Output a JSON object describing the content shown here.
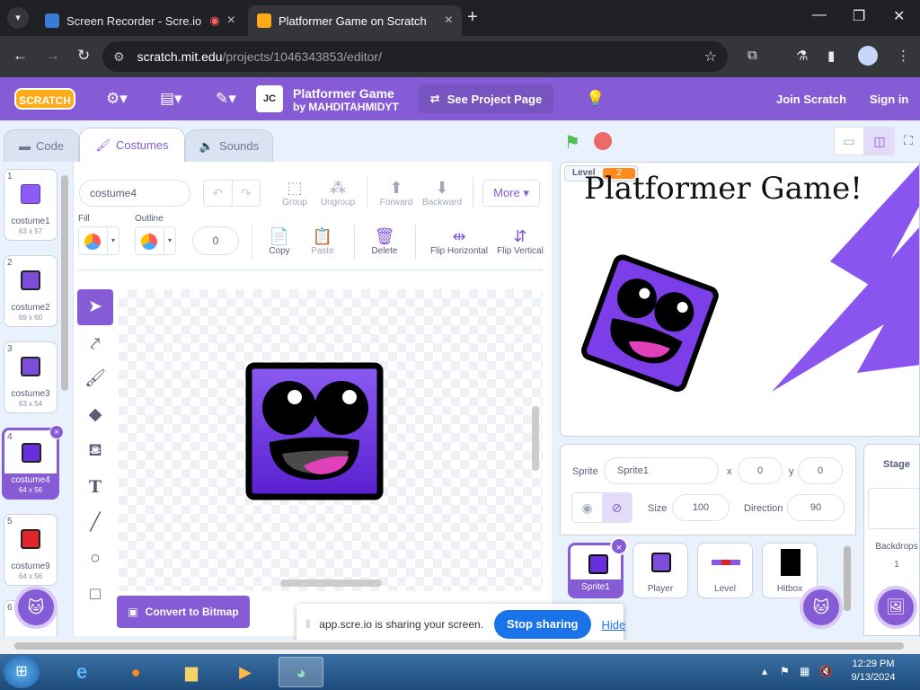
{
  "browser": {
    "tabs": [
      {
        "title": "Screen Recorder - Scre.io",
        "active": false
      },
      {
        "title": "Platformer Game on Scratch",
        "active": true
      }
    ],
    "url_host": "scratch.mit.edu",
    "url_path": "/projects/1046343853/editor/"
  },
  "scratch": {
    "logo": "SCRATCH",
    "project_title": "Platformer Game",
    "project_author": "by MAHDITAHMIDYT",
    "project_thumb_text": "JC",
    "see_project_page": "See Project Page",
    "join": "Join Scratch",
    "signin": "Sign in",
    "tabs": {
      "code": "Code",
      "costumes": "Costumes",
      "sounds": "Sounds"
    }
  },
  "costumes": [
    {
      "num": "1",
      "name": "costume1",
      "size": "63 x 57",
      "color": "#8b5cf6"
    },
    {
      "num": "2",
      "name": "costume2",
      "size": "69 x 60",
      "color": "#7c4ddb"
    },
    {
      "num": "3",
      "name": "costume3",
      "size": "63 x 54",
      "color": "#7c4ddb"
    },
    {
      "num": "4",
      "name": "costume4",
      "size": "64 x 56",
      "color": "#6a2fdc",
      "selected": true
    },
    {
      "num": "5",
      "name": "costume9",
      "size": "64 x 56",
      "color": "#e0262a"
    },
    {
      "num": "6"
    }
  ],
  "paint": {
    "costume_name": "costume4",
    "group": "Group",
    "ungroup": "Ungroup",
    "forward": "Forward",
    "backward": "Backward",
    "more": "More",
    "fill_label": "Fill",
    "outline_label": "Outline",
    "outline_width": "0",
    "copy": "Copy",
    "paste": "Paste",
    "delete": "Delete",
    "flip_h": "Flip Horizontal",
    "flip_v": "Flip Vertical",
    "convert": "Convert to Bitmap"
  },
  "stage": {
    "monitor_label": "Level",
    "monitor_value": "2",
    "title": "Platformer Game!"
  },
  "sprite_info": {
    "sprite_label": "Sprite",
    "sprite_name": "Sprite1",
    "x_label": "x",
    "x": "0",
    "y_label": "y",
    "y": "0",
    "size_label": "Size",
    "size": "100",
    "direction_label": "Direction",
    "direction": "90"
  },
  "sprites": [
    {
      "name": "Sprite1",
      "selected": true
    },
    {
      "name": "Player"
    },
    {
      "name": "Level"
    },
    {
      "name": "Hitbox"
    }
  ],
  "stage_panel": {
    "title": "Stage",
    "backdrops_label": "Backdrops",
    "backdrops_count": "1"
  },
  "share_bar": {
    "message": "app.scre.io is sharing your screen.",
    "stop": "Stop sharing",
    "hide": "Hide"
  },
  "taskbar": {
    "time": "12:29 PM",
    "date": "9/13/2024"
  },
  "colors": {
    "scratch_purple": "#855cd6",
    "character_purple": "#6a2fdc",
    "chrome_dark": "#202124"
  }
}
